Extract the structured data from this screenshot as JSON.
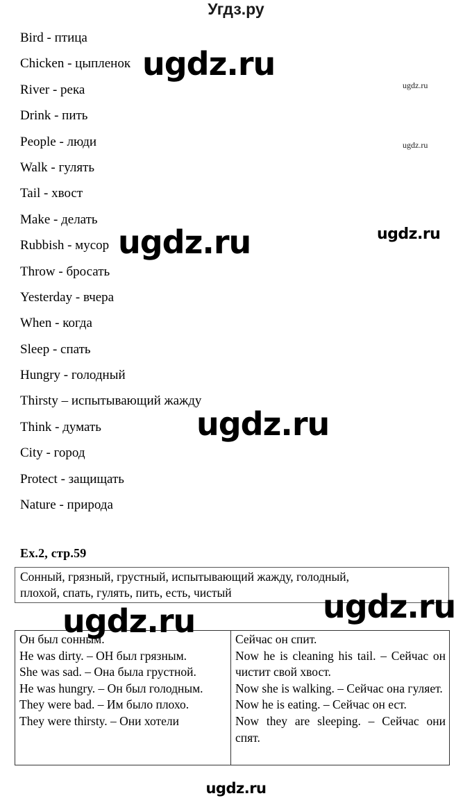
{
  "header": {
    "site_title": "Угдз.ру"
  },
  "vocabulary": {
    "items": [
      "Bird - птица",
      "Chicken - цыпленок",
      "River - река",
      "Drink - пить",
      "People - люди",
      "Walk - гулять",
      "Tail - хвост",
      "Make - делать",
      "Rubbish - мусор",
      "Throw - бросать",
      "Yesterday - вчера",
      "When - когда",
      "Sleep - спать",
      "Hungry - голодный",
      "Thirsty – испытывающий жажду",
      "Think - думать",
      "City - город",
      "Protect - защищать",
      "Nature  - природа"
    ]
  },
  "exercise": {
    "heading": "Ex.2, стр.59",
    "wordbank_line1": "Сонный, грязный, грустный, испытывающий жажду, голодный,",
    "wordbank_line2": "плохой, спать, гулять, пить, есть, чистый"
  },
  "answers": {
    "left_column": [
      "Он был сонным.",
      "He was dirty. – ОН был грязным.",
      "She was sad. – Она была грустной.",
      "He was hungry. – Он был голодным.",
      "They were bad. – Им было плохо.",
      "They were thirsty. – Они хотели"
    ],
    "right_column": [
      "Сейчас он спит.",
      "Now he is cleaning his tail. – Сейчас он чистит свой хвост.",
      "Now she is walking. – Сейчас она гуляет.",
      "Now he is eating. – Сейчас он ест.",
      "Now they are sleeping. – Сейчас они спят."
    ]
  },
  "watermarks": {
    "large": "ugdz.ru",
    "small": "ugdz.ru",
    "footer": "ugdz.ru"
  }
}
